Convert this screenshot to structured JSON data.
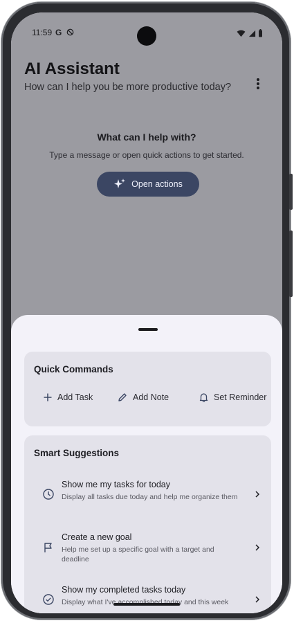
{
  "status_bar": {
    "time": "11:59",
    "g_label": "G"
  },
  "app": {
    "title": "AI Assistant",
    "subtitle": "How can I help you be more productive today?"
  },
  "empty_state": {
    "title": "What can I help with?",
    "text": "Type a message or open quick actions to get started.",
    "button_label": "Open actions"
  },
  "quick_commands": {
    "title": "Quick Commands",
    "items": [
      {
        "label": "Add Task",
        "icon": "plus-icon"
      },
      {
        "label": "Add Note",
        "icon": "pencil-icon"
      },
      {
        "label": "Set Reminder",
        "icon": "bell-icon"
      }
    ]
  },
  "smart_suggestions": {
    "title": "Smart Suggestions",
    "items": [
      {
        "title": "Show me my tasks for today",
        "description": "Display all tasks due today and help me organize them",
        "icon": "clock-icon"
      },
      {
        "title": "Create a new goal",
        "description": "Help me set up a specific goal with a target and deadline",
        "icon": "flag-icon"
      },
      {
        "title": "Show my completed tasks today",
        "description": "Display what I've accomplished today and this week",
        "icon": "check-circle-icon"
      }
    ]
  },
  "colors": {
    "accent": "#3b4663",
    "scrim": "#9b9ba1",
    "sheet": "#f3f2f9",
    "card": "#e3e2ea"
  }
}
